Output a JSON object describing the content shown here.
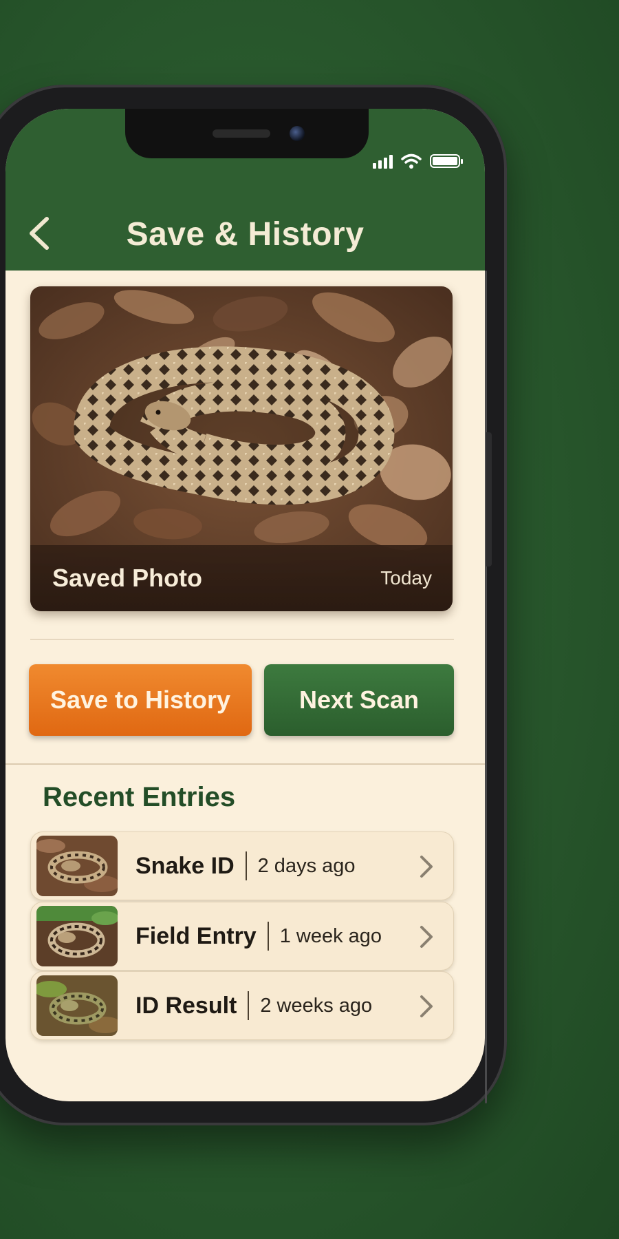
{
  "header": {
    "title": "Save & History",
    "back_icon": "chevron-left-icon"
  },
  "status_bar": {
    "icons": [
      "signal-icon",
      "wifi-icon",
      "battery-icon"
    ]
  },
  "photo": {
    "caption_title": "Saved Photo",
    "caption_date": "Today",
    "subject": "coiled snake on dry leaves"
  },
  "actions": {
    "save_label": "Save to History",
    "next_label": "Next Scan"
  },
  "recent": {
    "title": "Recent Entries",
    "items": [
      {
        "title": "Snake ID",
        "time": "2 days ago"
      },
      {
        "title": "Field Entry",
        "time": "1 week ago"
      },
      {
        "title": "ID Result",
        "time": "2 weeks ago"
      }
    ]
  },
  "colors": {
    "header": "#2f5f31",
    "accent_orange": "#e8761e",
    "accent_green": "#2f6b31",
    "card_bg": "#fbf0dc",
    "heading_green": "#234d27"
  }
}
